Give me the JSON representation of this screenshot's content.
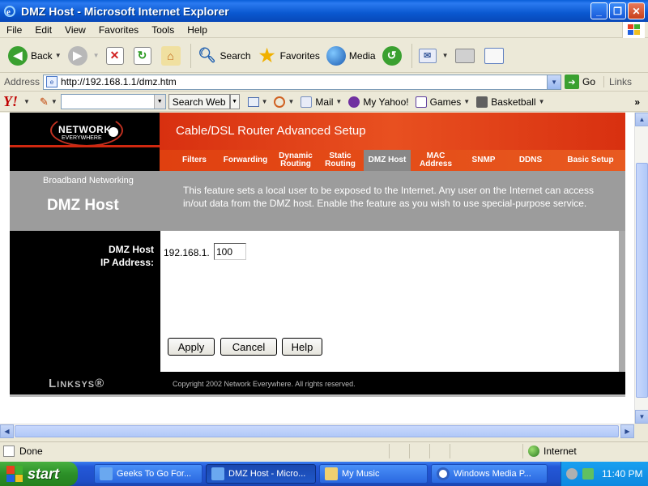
{
  "window": {
    "title": "DMZ Host - Microsoft Internet Explorer",
    "min_label": "_",
    "max_label": "❐",
    "close_label": "✕"
  },
  "menu": {
    "items": [
      "File",
      "Edit",
      "View",
      "Favorites",
      "Tools",
      "Help"
    ]
  },
  "toolbar": {
    "back_label": "Back",
    "search_label": "Search",
    "favorites_label": "Favorites",
    "media_label": "Media"
  },
  "address": {
    "label": "Address",
    "url": "http://192.168.1.1/dmz.htm",
    "go_label": "Go",
    "links_label": "Links"
  },
  "yahoo_toolbar": {
    "logo": "Y!",
    "search_button": "Search Web",
    "mail_label": "Mail",
    "myyahoo_label": "My Yahoo!",
    "games_label": "Games",
    "basketball_label": "Basketball",
    "more_label": "»"
  },
  "router": {
    "logo_text": "NETWORK",
    "logo_sub": "EVERYWHERE",
    "banner_title": "Cable/DSL Router Advanced Setup",
    "tabs": [
      {
        "label": "Filters"
      },
      {
        "label": "Forwarding"
      },
      {
        "label": "Dynamic Routing"
      },
      {
        "label": "Static Routing"
      },
      {
        "label": "DMZ Host"
      },
      {
        "label": "MAC Address"
      },
      {
        "label": "SNMP"
      },
      {
        "label": "DDNS"
      },
      {
        "label": "Basic Setup"
      }
    ],
    "active_tab": "DMZ Host",
    "section_label": "Broadband Networking",
    "page_title": "DMZ Host",
    "description": "This feature sets a local user to be exposed to the Internet. Any user on the Internet can access in/out data from the DMZ host. Enable the feature as you wish to use special-purpose service.",
    "field_label_line1": "DMZ Host",
    "field_label_line2": "IP Address:",
    "ip_prefix": "192.168.1.",
    "ip_value": "100",
    "apply_label": "Apply",
    "cancel_label": "Cancel",
    "help_label": "Help",
    "footer_brand": "Linksys®",
    "copyright": "Copyright 2002 Network Everywhere. All rights reserved."
  },
  "status": {
    "text": "Done",
    "zone": "Internet"
  },
  "taskbar": {
    "start_label": "start",
    "tasks": [
      {
        "label": "Geeks To Go For...",
        "active": false
      },
      {
        "label": "DMZ Host - Micro...",
        "active": true
      },
      {
        "label": "My Music",
        "active": false
      },
      {
        "label": "Windows Media P...",
        "active": false
      }
    ],
    "clock": "11:40 PM"
  },
  "colors": {
    "router_red": "#d83010",
    "router_grey": "#9c9c9c",
    "xp_blue": "#2458d8",
    "start_green": "#2c9028"
  }
}
